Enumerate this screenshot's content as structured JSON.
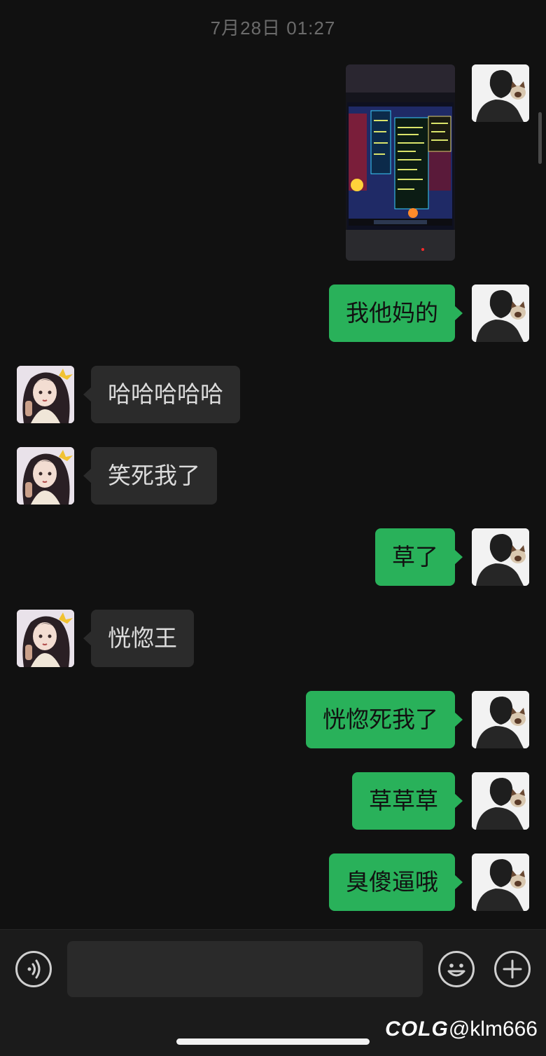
{
  "timestamp": "7月28日 01:27",
  "messages": [
    {
      "side": "out",
      "type": "image",
      "content_label": "game-screenshot-photo"
    },
    {
      "side": "out",
      "type": "text",
      "text": "我他妈的"
    },
    {
      "side": "in",
      "type": "text",
      "text": "哈哈哈哈哈"
    },
    {
      "side": "in",
      "type": "text",
      "text": "笑死我了"
    },
    {
      "side": "out",
      "type": "text",
      "text": "草了"
    },
    {
      "side": "in",
      "type": "text",
      "text": "恍惚王"
    },
    {
      "side": "out",
      "type": "text",
      "text": "恍惚死我了"
    },
    {
      "side": "out",
      "type": "text",
      "text": "草草草"
    },
    {
      "side": "out",
      "type": "text",
      "text": "臭傻逼哦"
    }
  ],
  "input_bar": {
    "voice_icon": "voice-icon",
    "emoji_icon": "emoji-icon",
    "plus_icon": "plus-icon",
    "input_value": ""
  },
  "watermark": {
    "logo": "COLG",
    "handle": "@klm666"
  },
  "colors": {
    "background": "#111111",
    "outgoing_bubble": "#29b15a",
    "incoming_bubble": "#2b2b2b"
  }
}
